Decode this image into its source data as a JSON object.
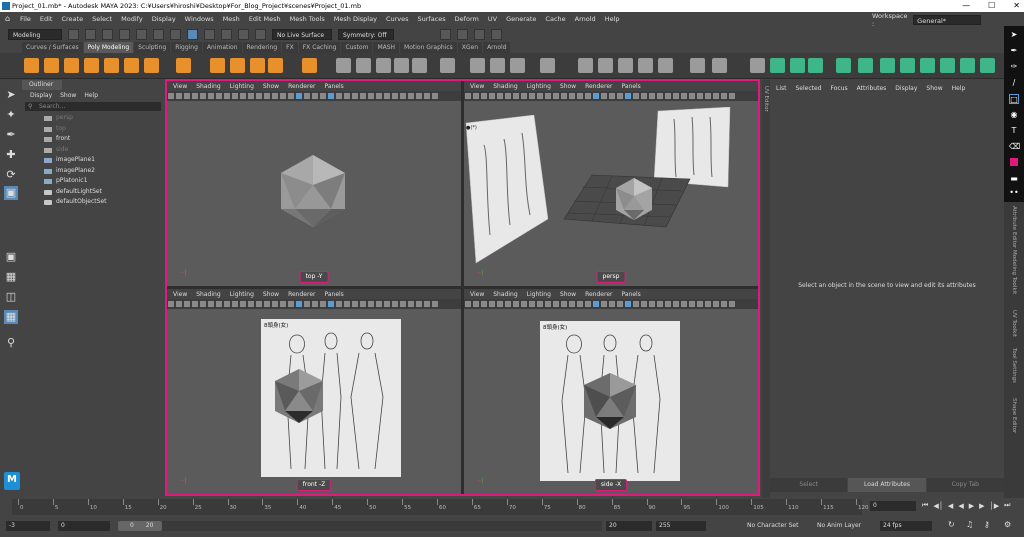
{
  "window": {
    "title": "Project_01.mb* - Autodesk MAYA 2023: C:¥Users¥hiroshi¥Desktop¥For_Blog_Project¥scenes¥Project_01.mb"
  },
  "menubar": {
    "items": [
      "File",
      "Edit",
      "Create",
      "Select",
      "Modify",
      "Display",
      "Windows",
      "Mesh",
      "Edit Mesh",
      "Mesh Tools",
      "Mesh Display",
      "Curves",
      "Surfaces",
      "Deform",
      "UV",
      "Generate",
      "Cache",
      "Arnold",
      "Help"
    ],
    "workspace_label": "Workspace :",
    "workspace_value": "General*"
  },
  "statusline": {
    "mode": "Modeling",
    "live_surface": "No Live Surface",
    "symmetry": "Symmetry: Off"
  },
  "shelf": {
    "tabs": [
      "Curves / Surfaces",
      "Poly Modeling",
      "Sculpting",
      "Rigging",
      "Animation",
      "Rendering",
      "FX",
      "FX Caching",
      "Custom",
      "MASH",
      "Motion Graphics",
      "XGen",
      "Arnold"
    ],
    "active_tab": 1,
    "accent_orange": "#e8902b",
    "accent_green": "#3fb58a"
  },
  "outliner": {
    "title": "Outliner",
    "menus": [
      "Display",
      "Show",
      "Help"
    ],
    "search_placeholder": "Search...",
    "items": [
      {
        "label": "persp",
        "dim": true
      },
      {
        "label": "top",
        "dim": true
      },
      {
        "label": "front",
        "dim": false
      },
      {
        "label": "side",
        "dim": true
      },
      {
        "label": "imagePlane1",
        "dim": false
      },
      {
        "label": "imagePlane2",
        "dim": false
      },
      {
        "label": "pPlatonic1",
        "dim": false
      },
      {
        "label": "defaultLightSet",
        "dim": false
      },
      {
        "label": "defaultObjectSet",
        "dim": false
      }
    ]
  },
  "viewports": {
    "menus": [
      "View",
      "Shading",
      "Lighting",
      "Show",
      "Renderer",
      "Panels"
    ],
    "highlight_color": "#e0197d",
    "panes": [
      {
        "camera": "top -Y"
      },
      {
        "camera": "persp"
      },
      {
        "camera": "front -Z"
      },
      {
        "camera": "side -X"
      }
    ],
    "sheet_caption_persp": "●(*)",
    "sheet_caption_front": "8頭身(女)",
    "sheet_caption_side": "8頭身(女)"
  },
  "attribute_editor": {
    "menus": [
      "List",
      "Selected",
      "Focus",
      "Attributes",
      "Display",
      "Show",
      "Help"
    ],
    "empty_message": "Select an object in the scene to view and edit its attributes",
    "buttons": [
      "Select",
      "Load Attributes",
      "Copy Tab"
    ],
    "edge_label": "UV Editor"
  },
  "side_tabs": [
    "Attribute Editor",
    "Modeling Toolkit",
    "UV Toolkit",
    "Tool Settings",
    "Shape Editor"
  ],
  "timeslider": {
    "ticks": [
      "0",
      "5",
      "10",
      "15",
      "20",
      "25",
      "30",
      "35",
      "40",
      "45",
      "50",
      "55",
      "60",
      "65",
      "70",
      "75",
      "80",
      "85",
      "90",
      "95",
      "100",
      "105",
      "110",
      "115",
      "120"
    ],
    "current_frame": "0"
  },
  "rangeslider": {
    "start_offset": "-3",
    "start": "0",
    "range_start": "0",
    "range_end": "20",
    "end": "20",
    "end_max": "255",
    "character_set": "No Character Set",
    "anim_layer": "No Anim Layer",
    "fps": "24 fps"
  }
}
